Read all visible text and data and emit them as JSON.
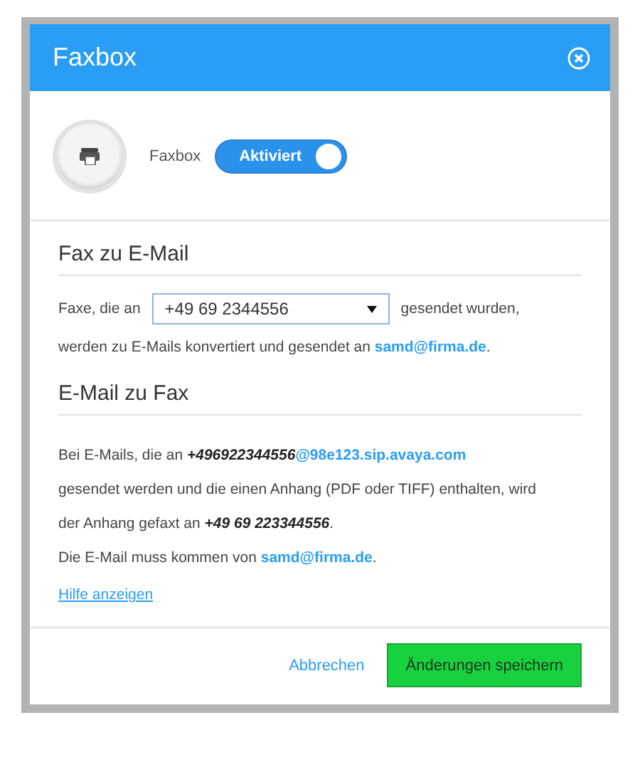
{
  "dialog": {
    "title": "Faxbox"
  },
  "toggle": {
    "label": "Faxbox",
    "state_text": "Aktiviert",
    "on": true
  },
  "fax_to_email": {
    "heading": "Fax zu E-Mail",
    "prefix": "Faxe, die an",
    "select_value": "+49 69 2344556",
    "suffix": "gesendet wurden,",
    "line": {
      "text": "werden zu E-Mails konvertiert und gesendet an",
      "link": "samd@firma.de",
      "after": "."
    }
  },
  "email_to_fax": {
    "heading": "E-Mail zu Fax",
    "lines": [
      {
        "text": "Bei E-Mails, die an **+496922344556**",
        "link": "@98e123.sip.avaya.com"
      },
      {
        "text": "gesendet werden und die einen Anhang (PDF oder TIFF) enthalten, wird"
      },
      {
        "text": "der Anhang gefaxt an **+49 69 223344556**."
      },
      {
        "text": "Die E-Mail muss kommen von ",
        "link": "samd@firma.de",
        "after": "."
      }
    ],
    "help_link": "Hilfe anzeigen"
  },
  "footer": {
    "cancel": "Abbrechen",
    "save": "Änderungen speichern"
  }
}
